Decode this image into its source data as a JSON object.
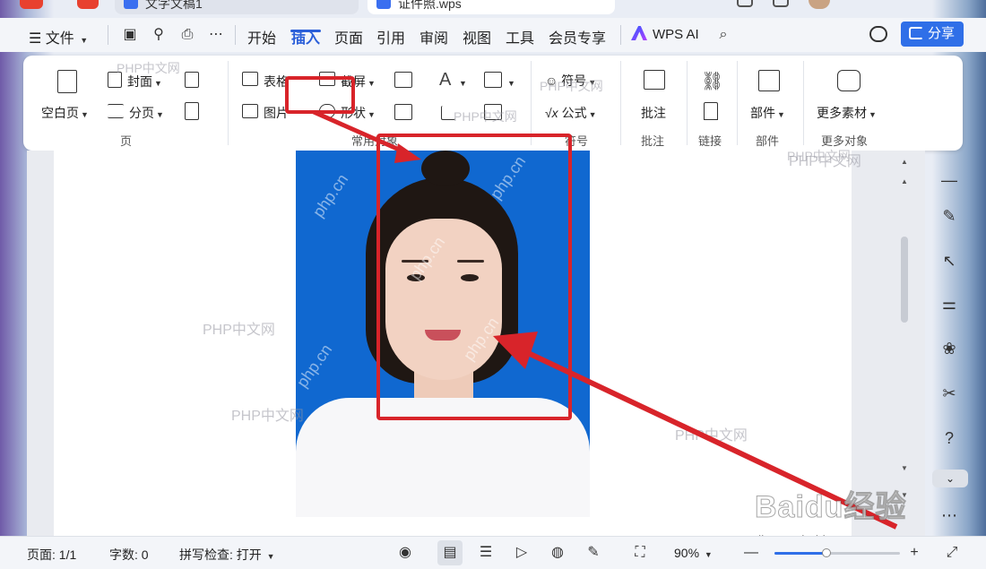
{
  "window": {
    "tabs": [
      {
        "label": "文字文稿1",
        "active": false
      },
      {
        "label": "证件照.wps",
        "active": true
      }
    ]
  },
  "menubar": {
    "file_label": "文件",
    "tabs": [
      "开始",
      "插入",
      "页面",
      "引用",
      "审阅",
      "视图",
      "工具",
      "会员专享"
    ],
    "active_tab": "插入",
    "ai_label": "WPS AI",
    "share_label": "分享"
  },
  "ribbon": {
    "blank_page": "空白页",
    "cover": "封面",
    "page_break": "分页",
    "table": "表格",
    "picture": "图片",
    "screenshot": "截屏",
    "shape": "形状",
    "symbol": "符号",
    "formula": "公式",
    "comment": "批注",
    "link_label": "",
    "part": "部件",
    "more_materials": "更多素材",
    "groups": {
      "page": "页",
      "common_objects": "常用对象",
      "symbol": "符号",
      "comment": "批注",
      "link": "链接",
      "part": "部件",
      "more_objects": "更多对象"
    }
  },
  "watermarks": [
    "PHP中文网",
    "php.cn"
  ],
  "baidu_mark": {
    "logo": "Baidu经验",
    "url": "jingyan.baidu.com"
  },
  "statusbar": {
    "page": "页面: 1/1",
    "word_count": "字数: 0",
    "spell_check": "拼写检查: 打开",
    "zoom": "90%"
  },
  "colors": {
    "accent": "#2b5fd9",
    "share_button": "#2f6fe8",
    "annotation_red": "#d8242a",
    "photo_background": "#1068d0"
  },
  "icons": [
    "search-icon",
    "save-icon",
    "print-icon",
    "cloud-icon",
    "share-icon",
    "eye-icon",
    "globe-icon",
    "pen-icon",
    "help-icon"
  ]
}
